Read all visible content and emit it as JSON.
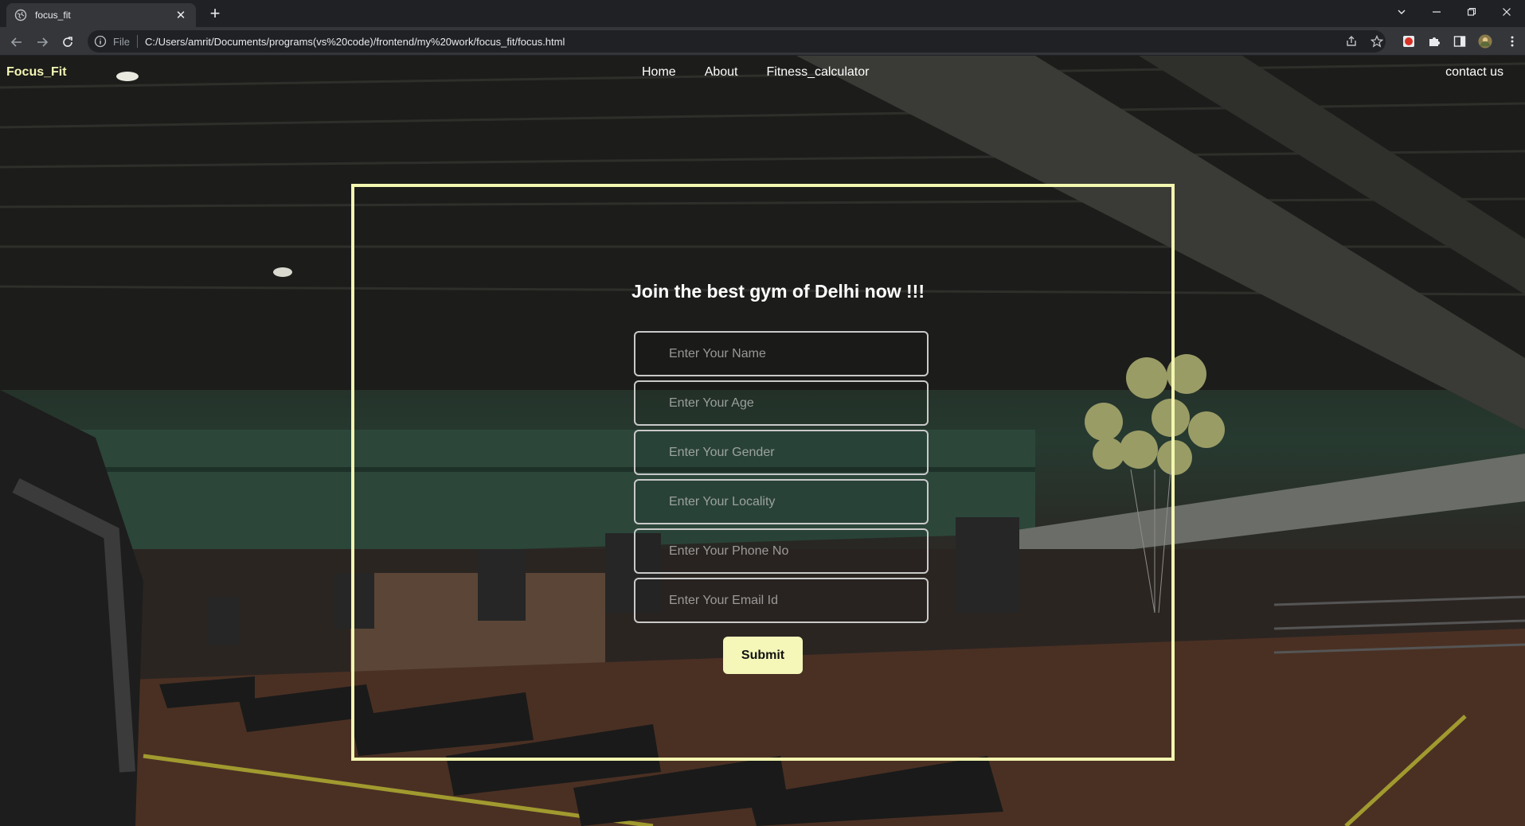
{
  "browser": {
    "tab_title": "focus_fit",
    "url_scheme": "File",
    "url": "C:/Users/amrit/Documents/programs(vs%20code)/frontend/my%20work/focus_fit/focus.html"
  },
  "site": {
    "brand": "Focus_Fit",
    "nav": {
      "home": "Home",
      "about": "About",
      "fitness": "Fitness_calculator",
      "contact": "contact us"
    },
    "form": {
      "title": "Join the best gym of Delhi now !!!",
      "name_placeholder": "Enter Your Name",
      "age_placeholder": "Enter Your Age",
      "gender_placeholder": "Enter Your Gender",
      "locality_placeholder": "Enter Your Locality",
      "phone_placeholder": "Enter Your Phone No",
      "email_placeholder": "Enter Your Email Id",
      "submit_label": "Submit"
    }
  },
  "colors": {
    "accent": "#f3f6b0",
    "chrome_bg": "#202124",
    "toolbar_bg": "#35363a"
  }
}
